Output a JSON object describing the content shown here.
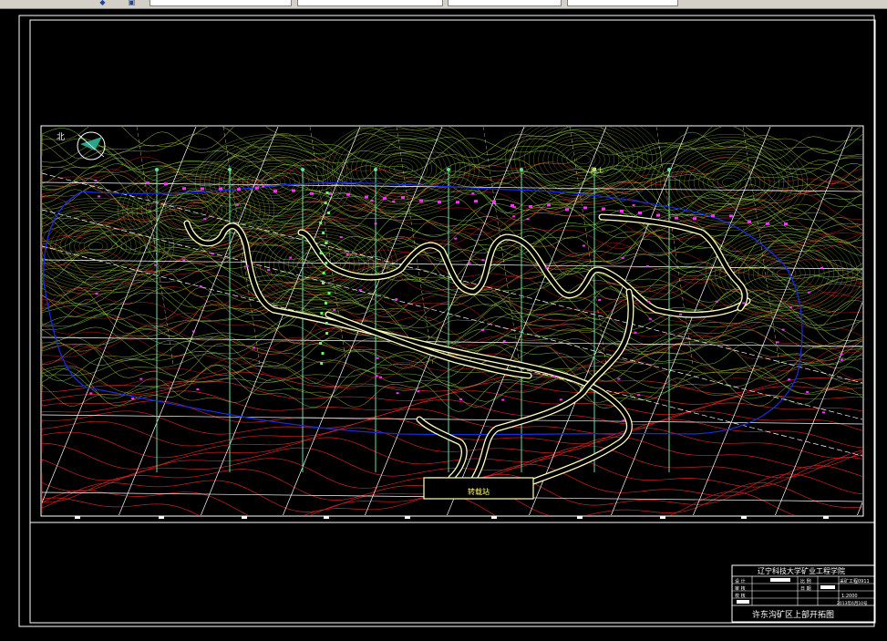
{
  "toolbar": {
    "fields": [
      "",
      "",
      "",
      "",
      "",
      ""
    ]
  },
  "drawing": {
    "north_label": "北",
    "station_label": "转载站",
    "road_label": "路土"
  },
  "title_block": {
    "org": "辽宁科技大学矿业工程学院",
    "rows": [
      {
        "k1": "设 计",
        "k2": "比 例",
        "v": "1:2000"
      },
      {
        "k1": "审 核",
        "k2": "日 期",
        "v": "2013年6月10号"
      },
      {
        "k1": "校 核",
        "k2": "",
        "v": ""
      }
    ],
    "drawing_no": "采矿工程0911",
    "drawing_title": "许东沟矿区上部开拓图"
  },
  "colors": {
    "frame": "#ffffff",
    "contour_green": "#7fbf3f",
    "contour_olive": "#9f9f3f",
    "contour_red": "#cc2222",
    "boundary_blue": "#1a2ad8",
    "road": "#ffffc0",
    "exploration_line": "#66e0a0",
    "magenta": "#ff33ff"
  }
}
